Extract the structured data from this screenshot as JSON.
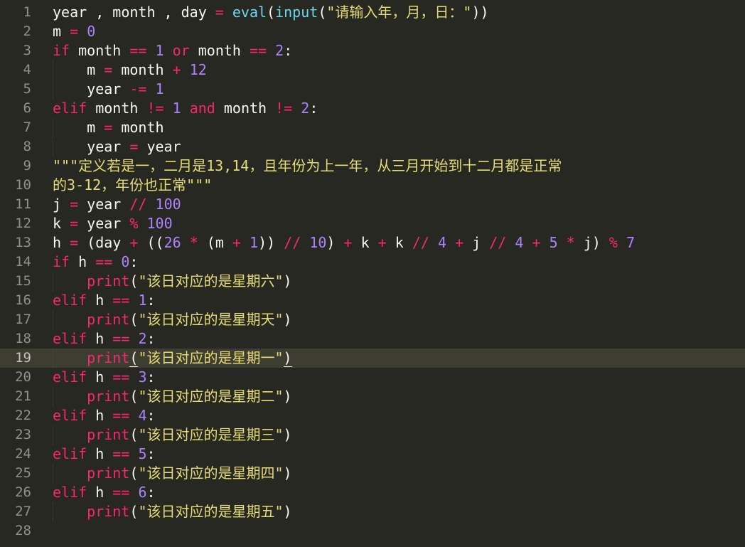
{
  "editor": {
    "active_line": 19,
    "colors": {
      "background": "#272822",
      "keyword": "#f92672",
      "builtin": "#66d9ef",
      "number": "#ae81ff",
      "string": "#e6db74",
      "gutter_text": "#90908a",
      "active_line_bg": "#3e3d32"
    },
    "lines": [
      {
        "number": "1",
        "indent": 0,
        "tokens": [
          {
            "text": "year , month , day ",
            "type": "pl"
          },
          {
            "text": "=",
            "type": "op"
          },
          {
            "text": " ",
            "type": "pl"
          },
          {
            "text": "eval",
            "type": "fn"
          },
          {
            "text": "(",
            "type": "pl"
          },
          {
            "text": "input",
            "type": "fn"
          },
          {
            "text": "(",
            "type": "pl"
          },
          {
            "text": "\"请输入年，月，日：\"",
            "type": "str"
          },
          {
            "text": "))",
            "type": "pl"
          }
        ]
      },
      {
        "number": "2",
        "indent": 0,
        "tokens": [
          {
            "text": "m ",
            "type": "pl"
          },
          {
            "text": "=",
            "type": "op"
          },
          {
            "text": " ",
            "type": "pl"
          },
          {
            "text": "0",
            "type": "num"
          }
        ]
      },
      {
        "number": "3",
        "indent": 0,
        "tokens": [
          {
            "text": "if",
            "type": "kw"
          },
          {
            "text": " month ",
            "type": "pl"
          },
          {
            "text": "==",
            "type": "op"
          },
          {
            "text": " ",
            "type": "pl"
          },
          {
            "text": "1",
            "type": "num"
          },
          {
            "text": " ",
            "type": "pl"
          },
          {
            "text": "or",
            "type": "kw"
          },
          {
            "text": " month ",
            "type": "pl"
          },
          {
            "text": "==",
            "type": "op"
          },
          {
            "text": " ",
            "type": "pl"
          },
          {
            "text": "2",
            "type": "num"
          },
          {
            "text": ":",
            "type": "pl"
          }
        ]
      },
      {
        "number": "4",
        "indent": 1,
        "tokens": [
          {
            "text": "    m ",
            "type": "pl"
          },
          {
            "text": "=",
            "type": "op"
          },
          {
            "text": " month ",
            "type": "pl"
          },
          {
            "text": "+",
            "type": "op"
          },
          {
            "text": " ",
            "type": "pl"
          },
          {
            "text": "12",
            "type": "num"
          }
        ]
      },
      {
        "number": "5",
        "indent": 1,
        "tokens": [
          {
            "text": "    year ",
            "type": "pl"
          },
          {
            "text": "-=",
            "type": "op"
          },
          {
            "text": " ",
            "type": "pl"
          },
          {
            "text": "1",
            "type": "num"
          }
        ]
      },
      {
        "number": "6",
        "indent": 0,
        "tokens": [
          {
            "text": "elif",
            "type": "kw"
          },
          {
            "text": " month ",
            "type": "pl"
          },
          {
            "text": "!=",
            "type": "op"
          },
          {
            "text": " ",
            "type": "pl"
          },
          {
            "text": "1",
            "type": "num"
          },
          {
            "text": " ",
            "type": "pl"
          },
          {
            "text": "and",
            "type": "kw"
          },
          {
            "text": " month ",
            "type": "pl"
          },
          {
            "text": "!=",
            "type": "op"
          },
          {
            "text": " ",
            "type": "pl"
          },
          {
            "text": "2",
            "type": "num"
          },
          {
            "text": ":",
            "type": "pl"
          }
        ]
      },
      {
        "number": "7",
        "indent": 1,
        "tokens": [
          {
            "text": "    m ",
            "type": "pl"
          },
          {
            "text": "=",
            "type": "op"
          },
          {
            "text": " month",
            "type": "pl"
          }
        ]
      },
      {
        "number": "8",
        "indent": 1,
        "tokens": [
          {
            "text": "    year ",
            "type": "pl"
          },
          {
            "text": "=",
            "type": "op"
          },
          {
            "text": " year",
            "type": "pl"
          }
        ]
      },
      {
        "number": "9",
        "indent": 0,
        "tokens": [
          {
            "text": "\"\"\"定义若是一，二月是13,14，且年份为上一年，从三月开始到十二月都是正常",
            "type": "doc"
          }
        ]
      },
      {
        "number": "10",
        "indent": 0,
        "tokens": [
          {
            "text": "的3-12，年份也正常\"\"\"",
            "type": "doc"
          }
        ]
      },
      {
        "number": "11",
        "indent": 0,
        "tokens": [
          {
            "text": "j ",
            "type": "pl"
          },
          {
            "text": "=",
            "type": "op"
          },
          {
            "text": " year ",
            "type": "pl"
          },
          {
            "text": "//",
            "type": "op"
          },
          {
            "text": " ",
            "type": "pl"
          },
          {
            "text": "100",
            "type": "num"
          }
        ]
      },
      {
        "number": "12",
        "indent": 0,
        "tokens": [
          {
            "text": "k ",
            "type": "pl"
          },
          {
            "text": "=",
            "type": "op"
          },
          {
            "text": " year ",
            "type": "pl"
          },
          {
            "text": "%",
            "type": "op"
          },
          {
            "text": " ",
            "type": "pl"
          },
          {
            "text": "100",
            "type": "num"
          }
        ]
      },
      {
        "number": "13",
        "indent": 0,
        "tokens": [
          {
            "text": "h ",
            "type": "pl"
          },
          {
            "text": "=",
            "type": "op"
          },
          {
            "text": " (day ",
            "type": "pl"
          },
          {
            "text": "+",
            "type": "op"
          },
          {
            "text": " ((",
            "type": "pl"
          },
          {
            "text": "26",
            "type": "num"
          },
          {
            "text": " ",
            "type": "pl"
          },
          {
            "text": "*",
            "type": "op"
          },
          {
            "text": " (m ",
            "type": "pl"
          },
          {
            "text": "+",
            "type": "op"
          },
          {
            "text": " ",
            "type": "pl"
          },
          {
            "text": "1",
            "type": "num"
          },
          {
            "text": ")) ",
            "type": "pl"
          },
          {
            "text": "//",
            "type": "op"
          },
          {
            "text": " ",
            "type": "pl"
          },
          {
            "text": "10",
            "type": "num"
          },
          {
            "text": ") ",
            "type": "pl"
          },
          {
            "text": "+",
            "type": "op"
          },
          {
            "text": " k ",
            "type": "pl"
          },
          {
            "text": "+",
            "type": "op"
          },
          {
            "text": " k ",
            "type": "pl"
          },
          {
            "text": "//",
            "type": "op"
          },
          {
            "text": " ",
            "type": "pl"
          },
          {
            "text": "4",
            "type": "num"
          },
          {
            "text": " ",
            "type": "pl"
          },
          {
            "text": "+",
            "type": "op"
          },
          {
            "text": " j ",
            "type": "pl"
          },
          {
            "text": "//",
            "type": "op"
          },
          {
            "text": " ",
            "type": "pl"
          },
          {
            "text": "4",
            "type": "num"
          },
          {
            "text": " ",
            "type": "pl"
          },
          {
            "text": "+",
            "type": "op"
          },
          {
            "text": " ",
            "type": "pl"
          },
          {
            "text": "5",
            "type": "num"
          },
          {
            "text": " ",
            "type": "pl"
          },
          {
            "text": "*",
            "type": "op"
          },
          {
            "text": " j) ",
            "type": "pl"
          },
          {
            "text": "%",
            "type": "op"
          },
          {
            "text": " ",
            "type": "pl"
          },
          {
            "text": "7",
            "type": "num"
          }
        ]
      },
      {
        "number": "14",
        "indent": 0,
        "tokens": [
          {
            "text": "if",
            "type": "kw"
          },
          {
            "text": " h ",
            "type": "pl"
          },
          {
            "text": "==",
            "type": "op"
          },
          {
            "text": " ",
            "type": "pl"
          },
          {
            "text": "0",
            "type": "num"
          },
          {
            "text": ":",
            "type": "pl"
          }
        ]
      },
      {
        "number": "15",
        "indent": 1,
        "tokens": [
          {
            "text": "    ",
            "type": "pl"
          },
          {
            "text": "print",
            "type": "bi"
          },
          {
            "text": "(",
            "type": "pl"
          },
          {
            "text": "\"该日对应的是星期六\"",
            "type": "str"
          },
          {
            "text": ")",
            "type": "pl"
          }
        ]
      },
      {
        "number": "16",
        "indent": 0,
        "tokens": [
          {
            "text": "elif",
            "type": "kw"
          },
          {
            "text": " h ",
            "type": "pl"
          },
          {
            "text": "==",
            "type": "op"
          },
          {
            "text": " ",
            "type": "pl"
          },
          {
            "text": "1",
            "type": "num"
          },
          {
            "text": ":",
            "type": "pl"
          }
        ]
      },
      {
        "number": "17",
        "indent": 1,
        "tokens": [
          {
            "text": "    ",
            "type": "pl"
          },
          {
            "text": "print",
            "type": "bi"
          },
          {
            "text": "(",
            "type": "pl"
          },
          {
            "text": "\"该日对应的是星期天\"",
            "type": "str"
          },
          {
            "text": ")",
            "type": "pl"
          }
        ]
      },
      {
        "number": "18",
        "indent": 0,
        "tokens": [
          {
            "text": "elif",
            "type": "kw"
          },
          {
            "text": " h ",
            "type": "pl"
          },
          {
            "text": "==",
            "type": "op"
          },
          {
            "text": " ",
            "type": "pl"
          },
          {
            "text": "2",
            "type": "num"
          },
          {
            "text": ":",
            "type": "pl"
          }
        ]
      },
      {
        "number": "19",
        "indent": 1,
        "tokens": [
          {
            "text": "    ",
            "type": "pl"
          },
          {
            "text": "print",
            "type": "bi"
          },
          {
            "text": "(",
            "type": "pl",
            "match": true
          },
          {
            "text": "\"该日对应的是星期一\"",
            "type": "str"
          },
          {
            "text": ")",
            "type": "pl",
            "match": true
          }
        ]
      },
      {
        "number": "20",
        "indent": 0,
        "tokens": [
          {
            "text": "elif",
            "type": "kw"
          },
          {
            "text": " h ",
            "type": "pl"
          },
          {
            "text": "==",
            "type": "op"
          },
          {
            "text": " ",
            "type": "pl"
          },
          {
            "text": "3",
            "type": "num"
          },
          {
            "text": ":",
            "type": "pl"
          }
        ]
      },
      {
        "number": "21",
        "indent": 1,
        "tokens": [
          {
            "text": "    ",
            "type": "pl"
          },
          {
            "text": "print",
            "type": "bi"
          },
          {
            "text": "(",
            "type": "pl"
          },
          {
            "text": "\"该日对应的是星期二\"",
            "type": "str"
          },
          {
            "text": ")",
            "type": "pl"
          }
        ]
      },
      {
        "number": "22",
        "indent": 0,
        "tokens": [
          {
            "text": "elif",
            "type": "kw"
          },
          {
            "text": " h ",
            "type": "pl"
          },
          {
            "text": "==",
            "type": "op"
          },
          {
            "text": " ",
            "type": "pl"
          },
          {
            "text": "4",
            "type": "num"
          },
          {
            "text": ":",
            "type": "pl"
          }
        ]
      },
      {
        "number": "23",
        "indent": 1,
        "tokens": [
          {
            "text": "    ",
            "type": "pl"
          },
          {
            "text": "print",
            "type": "bi"
          },
          {
            "text": "(",
            "type": "pl"
          },
          {
            "text": "\"该日对应的是星期三\"",
            "type": "str"
          },
          {
            "text": ")",
            "type": "pl"
          }
        ]
      },
      {
        "number": "24",
        "indent": 0,
        "tokens": [
          {
            "text": "elif",
            "type": "kw"
          },
          {
            "text": " h ",
            "type": "pl"
          },
          {
            "text": "==",
            "type": "op"
          },
          {
            "text": " ",
            "type": "pl"
          },
          {
            "text": "5",
            "type": "num"
          },
          {
            "text": ":",
            "type": "pl"
          }
        ]
      },
      {
        "number": "25",
        "indent": 1,
        "tokens": [
          {
            "text": "    ",
            "type": "pl"
          },
          {
            "text": "print",
            "type": "bi"
          },
          {
            "text": "(",
            "type": "pl"
          },
          {
            "text": "\"该日对应的是星期四\"",
            "type": "str"
          },
          {
            "text": ")",
            "type": "pl"
          }
        ]
      },
      {
        "number": "26",
        "indent": 0,
        "tokens": [
          {
            "text": "elif",
            "type": "kw"
          },
          {
            "text": " h ",
            "type": "pl"
          },
          {
            "text": "==",
            "type": "op"
          },
          {
            "text": " ",
            "type": "pl"
          },
          {
            "text": "6",
            "type": "num"
          },
          {
            "text": ":",
            "type": "pl"
          }
        ]
      },
      {
        "number": "27",
        "indent": 1,
        "tokens": [
          {
            "text": "    ",
            "type": "pl"
          },
          {
            "text": "print",
            "type": "bi"
          },
          {
            "text": "(",
            "type": "pl"
          },
          {
            "text": "\"该日对应的是星期五\"",
            "type": "str"
          },
          {
            "text": ")",
            "type": "pl"
          }
        ]
      },
      {
        "number": "28",
        "indent": 0,
        "tokens": []
      }
    ]
  }
}
